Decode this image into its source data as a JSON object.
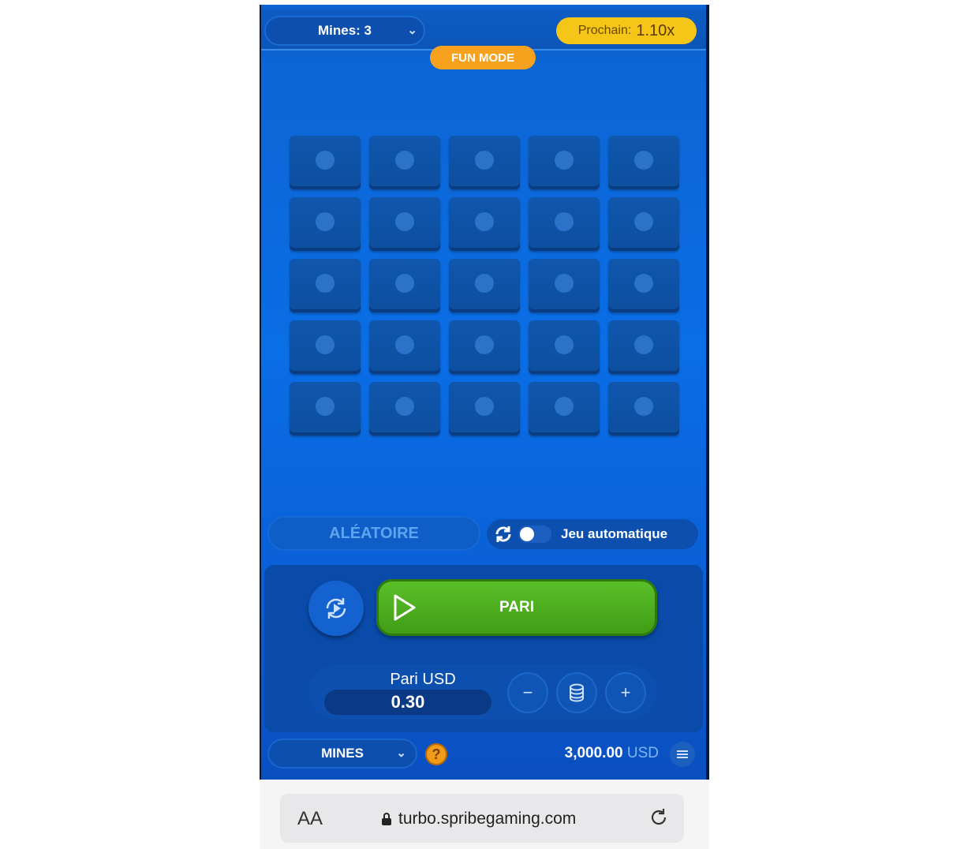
{
  "header": {
    "mines_label": "Mines: 3",
    "next_label": "Prochain:",
    "next_value": "1.10x",
    "fun_mode": "FUN MODE"
  },
  "grid": {
    "rows": 5,
    "cols": 5,
    "tile_icon": "dot-icon"
  },
  "controls": {
    "random_label": "ALÉATOIRE",
    "autoplay_label": "Jeu automatique",
    "autoplay_on": false
  },
  "bet": {
    "button_label": "PARI",
    "stake_label": "Pari USD",
    "stake_value": "0.30",
    "minus": "−",
    "plus": "+"
  },
  "footer": {
    "game_name": "MINES",
    "help": "?",
    "balance_amount": "3,000.00",
    "balance_currency": "USD"
  },
  "browser": {
    "text_size": "AA",
    "url": "turbo.spribegaming.com"
  },
  "colors": {
    "game_bg": "#0a6ee6",
    "next_pill": "#f5c518",
    "fun_badge": "#f7a21e",
    "bet_button": "#4fae1f"
  }
}
